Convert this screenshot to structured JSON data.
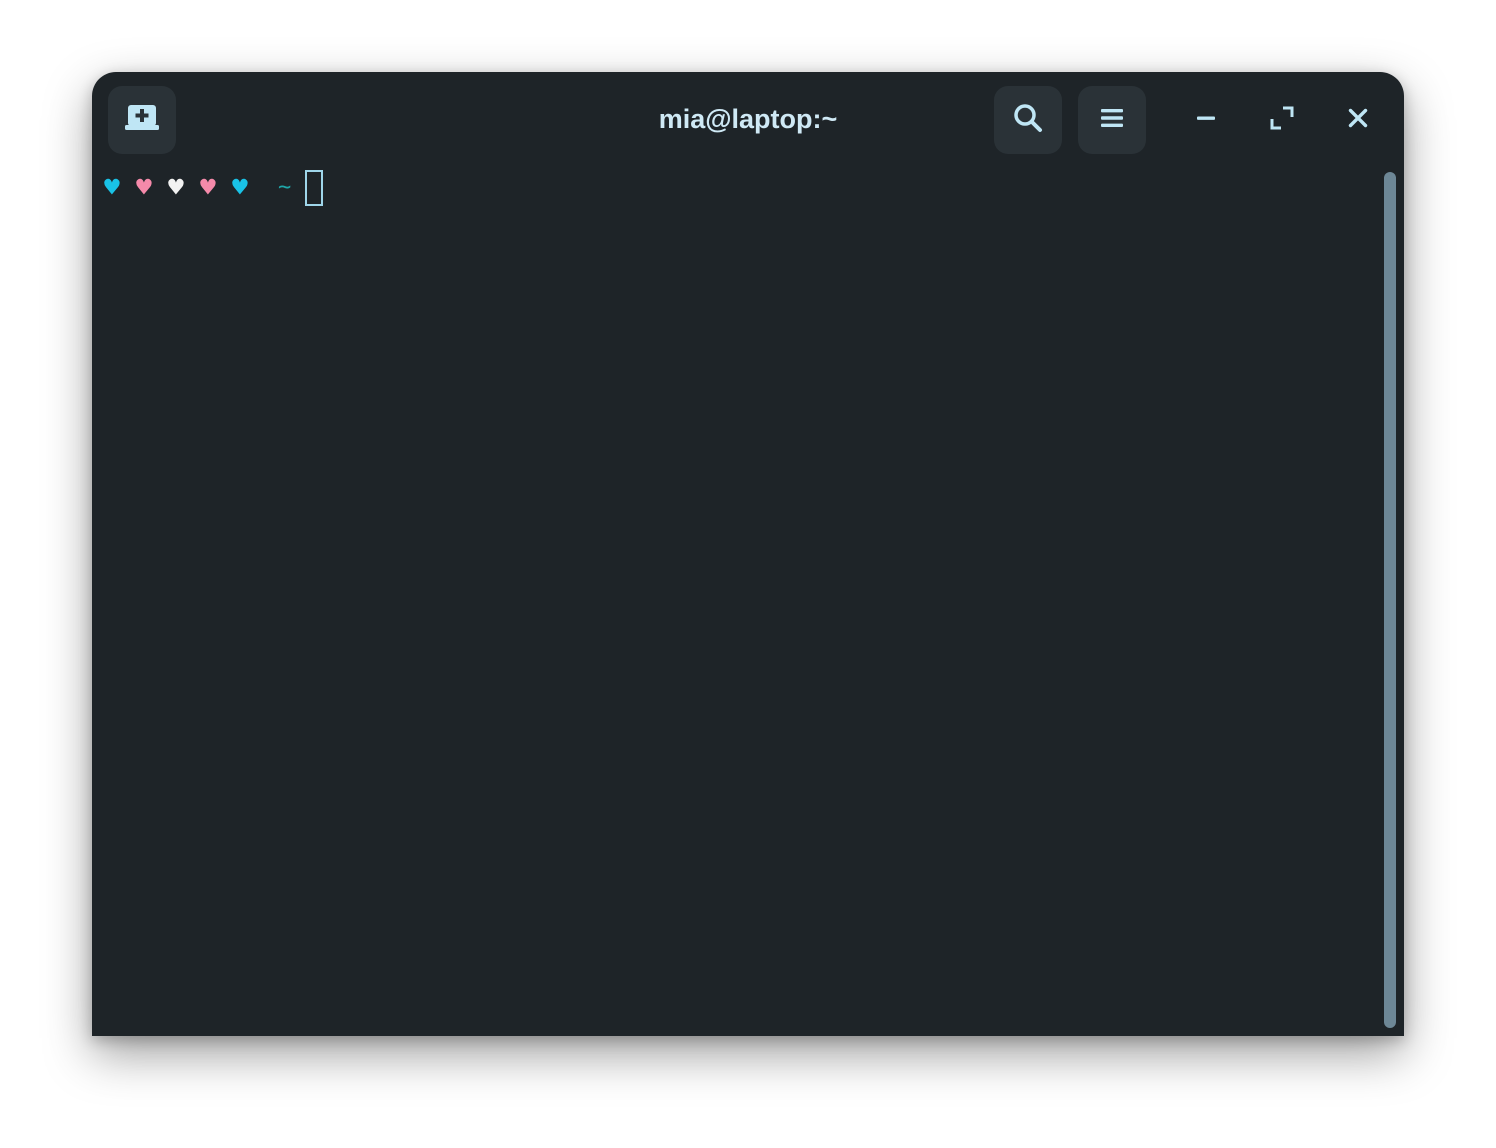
{
  "window": {
    "title": "mia@laptop:~"
  },
  "headerbar": {
    "new_tab_icon": "new-tab-icon",
    "search_icon": "search-icon",
    "menu_icon": "hamburger-menu-icon",
    "minimize_icon": "minimize-icon",
    "maximize_icon": "maximize-icon",
    "close_icon": "close-icon"
  },
  "terminal": {
    "prompt_hearts": [
      {
        "glyph": "♥",
        "color": "#19c2e6"
      },
      {
        "glyph": "♥",
        "color": "#f58aaa"
      },
      {
        "glyph": "♥",
        "color": "#f2f2f2"
      },
      {
        "glyph": "♥",
        "color": "#f58aaa"
      },
      {
        "glyph": "♥",
        "color": "#19c2e6"
      }
    ],
    "cwd": "~"
  },
  "colors": {
    "background": "#1e2428",
    "title_text": "#cfe9f5",
    "button_bg": "#2a3237",
    "icon": "#bfe6f5",
    "cwd": "#1fa7a9",
    "scrollbar": "#6d8796"
  }
}
